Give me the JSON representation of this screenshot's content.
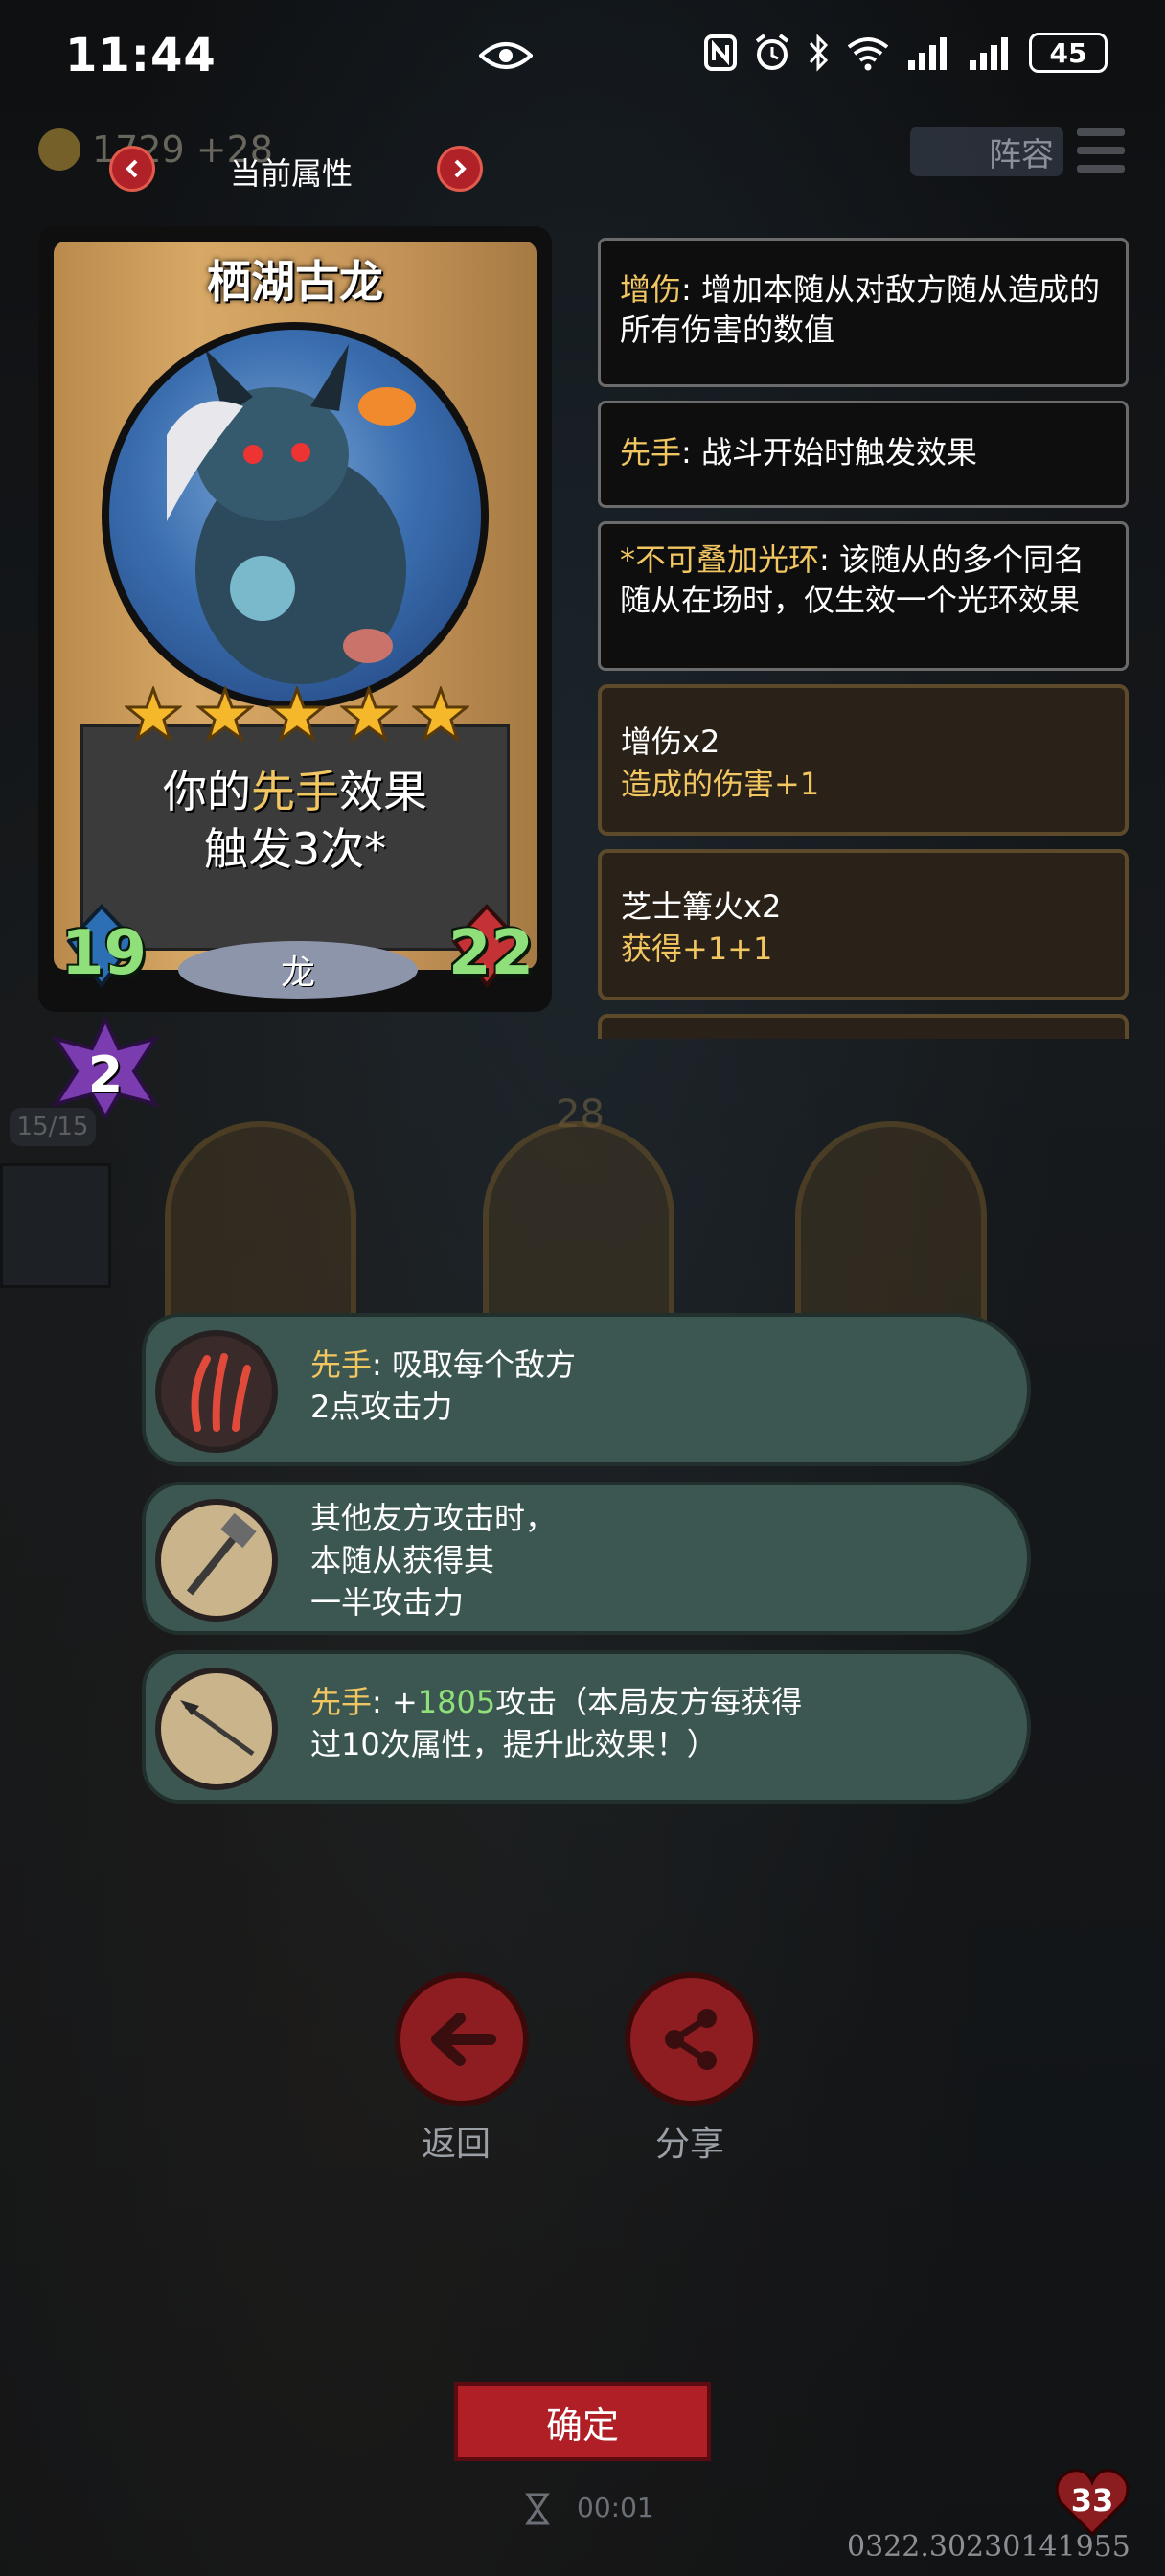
{
  "status_bar": {
    "time": "11:44",
    "battery": "45"
  },
  "top_bar": {
    "gold": "1729 +28",
    "panel_title": "当前属性",
    "lineup_label": "阵容"
  },
  "card": {
    "name": "栖湖古龙",
    "stars": 5,
    "desc_prefix": "你的",
    "desc_keyword": "先手",
    "desc_suffix": "效果",
    "desc_line2": "触发3次*",
    "attack": "19",
    "health": "22",
    "tribe": "龙",
    "level": "2"
  },
  "keywords": [
    {
      "key": "增伤",
      "text": ": 增加本随从对敌方随从造成的所有伤害的数值"
    },
    {
      "key": "先手",
      "text": ": 战斗开始时触发效果"
    },
    {
      "key": "*不可叠加光环",
      "text": ": 该随从的多个同名随从在场时，仅生效一个光环效果"
    }
  ],
  "buffs": [
    {
      "title": "增伤x2",
      "detail": "造成的伤害+1"
    },
    {
      "title": "芝士篝火x2",
      "detail": "获得+1+1"
    }
  ],
  "board": {
    "count": "15/15",
    "tier_number": "28"
  },
  "abilities": [
    {
      "key": "先手",
      "line1": ": 吸取每个敌方",
      "line2": "2点攻击力"
    },
    {
      "line1": "其他友方攻击时，",
      "line2": "本随从获得其",
      "line3": "一半攻击力"
    },
    {
      "key": "先手",
      "pre": ": +",
      "value": "1805",
      "line1": "攻击（本局友方每获得",
      "line2": "过10次属性，提升此效果！）"
    }
  ],
  "buttons": {
    "back": "返回",
    "share": "分享",
    "confirm": "确定"
  },
  "timer": "00:01",
  "player_hp": "33",
  "version": "0322.30230141955"
}
